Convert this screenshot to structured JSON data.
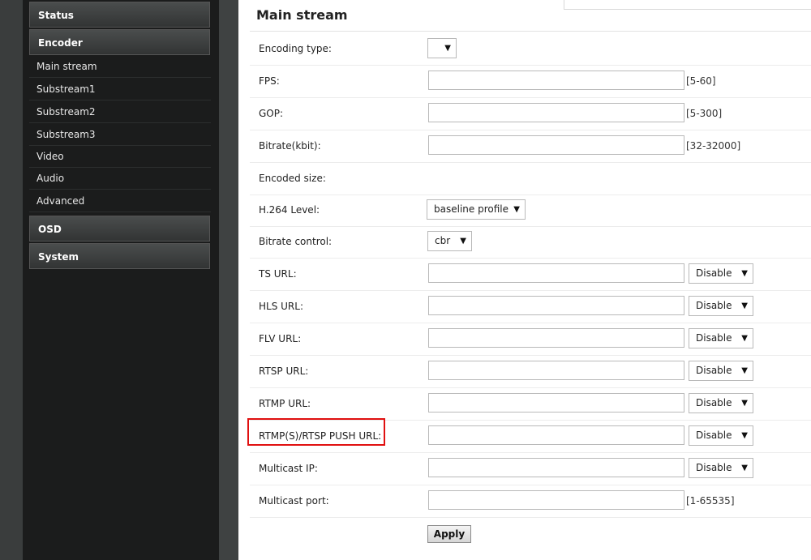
{
  "sidebar": {
    "sections": {
      "status": "Status",
      "encoder": "Encoder",
      "osd": "OSD",
      "system": "System"
    },
    "encoder_items": [
      "Main stream",
      "Substream1",
      "Substream2",
      "Substream3",
      "Video",
      "Audio",
      "Advanced"
    ]
  },
  "main": {
    "title": "Main stream",
    "fields": {
      "encoding_type": {
        "label": "Encoding type:",
        "value": ""
      },
      "fps": {
        "label": "FPS:",
        "value": "",
        "range": "[5-60]"
      },
      "gop": {
        "label": "GOP:",
        "value": "",
        "range": "[5-300]"
      },
      "bitrate": {
        "label": "Bitrate(kbit):",
        "value": "",
        "range": "[32-32000]"
      },
      "encoded_size": {
        "label": "Encoded size:"
      },
      "h264_level": {
        "label": "H.264 Level:",
        "value": "baseline profile"
      },
      "bitrate_control": {
        "label": "Bitrate control:",
        "value": "cbr"
      },
      "ts_url": {
        "label": "TS URL:",
        "value": "",
        "mode": "Disable"
      },
      "hls_url": {
        "label": "HLS URL:",
        "value": "",
        "mode": "Disable"
      },
      "flv_url": {
        "label": "FLV URL:",
        "value": "",
        "mode": "Disable"
      },
      "rtsp_url": {
        "label": "RTSP URL:",
        "value": "",
        "mode": "Disable"
      },
      "rtmp_url": {
        "label": "RTMP URL:",
        "value": "",
        "mode": "Disable"
      },
      "push_url": {
        "label": "RTMP(S)/RTSP PUSH URL:",
        "value": "",
        "mode": "Disable"
      },
      "multicast_ip": {
        "label": "Multicast IP:",
        "value": "",
        "mode": "Disable"
      },
      "multicast_port": {
        "label": "Multicast port:",
        "value": "",
        "range": "[1-65535]"
      }
    },
    "apply_label": "Apply",
    "dropdown_arrow": "▼"
  },
  "colors": {
    "sidebar_bg": "#1b1c1c",
    "highlight": "#e01010"
  }
}
